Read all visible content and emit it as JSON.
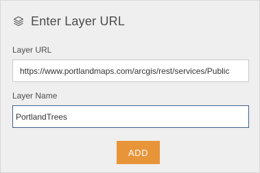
{
  "panel": {
    "title": "Enter Layer URL",
    "title_icon": "layers-icon"
  },
  "layer_url": {
    "label": "Layer URL",
    "value": "https://www.portlandmaps.com/arcgis/rest/services/Public"
  },
  "layer_name": {
    "label": "Layer Name",
    "value": "PortlandTrees"
  },
  "actions": {
    "add_label": "ADD"
  },
  "colors": {
    "accent": "#e8953a",
    "focus_border": "#3e5f8a",
    "panel_bg": "#efefef"
  }
}
